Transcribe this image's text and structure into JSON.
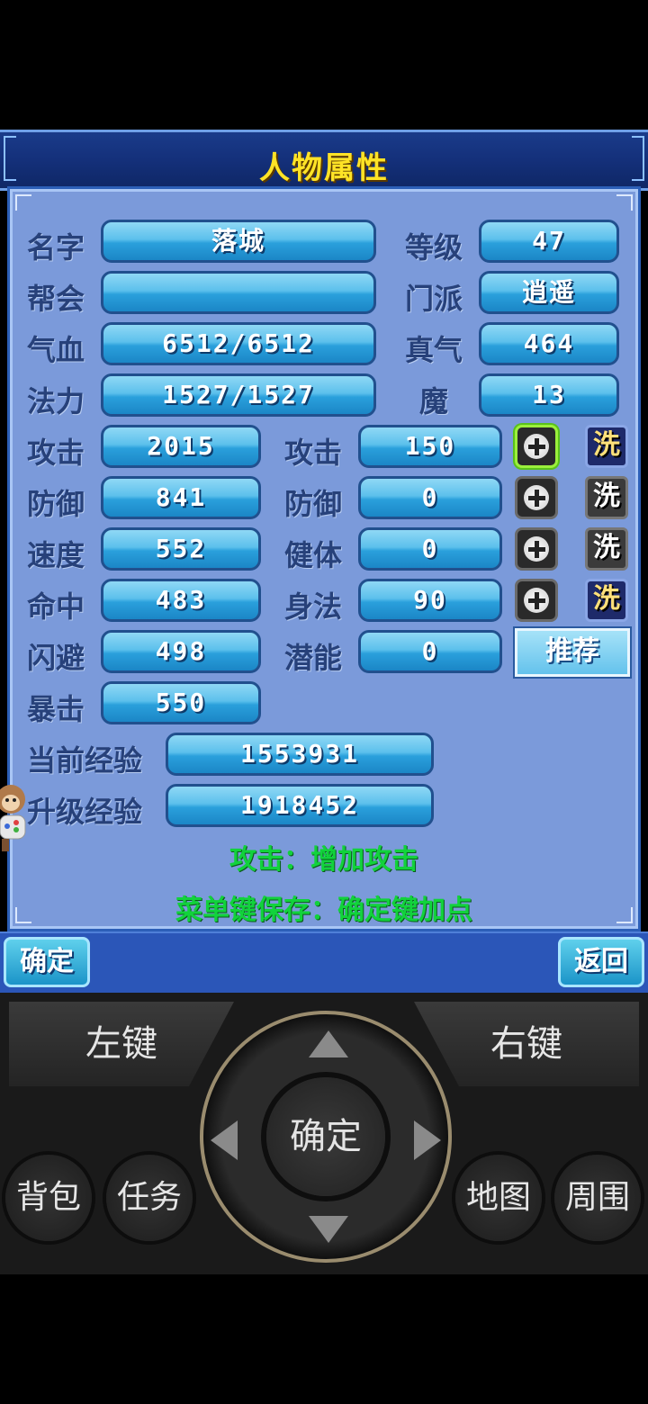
{
  "title": "人物属性",
  "top_rows": [
    {
      "label": "名字",
      "value": "落城",
      "label2": "等级",
      "value2": "47"
    },
    {
      "label": "帮会",
      "value": "",
      "label2": "门派",
      "value2": "逍遥"
    },
    {
      "label": "气血",
      "value": "6512/6512",
      "label2": "真气",
      "value2": "464"
    },
    {
      "label": "法力",
      "value": "1527/1527",
      "label2": "魔",
      "value2": "13"
    }
  ],
  "stat_rows": [
    {
      "label": "攻击",
      "value": "2015",
      "alloc_label": "攻击",
      "alloc_value": "150",
      "wash": "洗"
    },
    {
      "label": "防御",
      "value": "841",
      "alloc_label": "防御",
      "alloc_value": "0",
      "wash": "洗"
    },
    {
      "label": "速度",
      "value": "552",
      "alloc_label": "健体",
      "alloc_value": "0",
      "wash": "洗"
    },
    {
      "label": "命中",
      "value": "483",
      "alloc_label": "身法",
      "alloc_value": "90",
      "wash": "洗"
    },
    {
      "label": "闪避",
      "value": "498",
      "alloc_label": "潜能",
      "alloc_value": "0"
    },
    {
      "label": "暴击",
      "value": "550"
    }
  ],
  "recommend_label": "推荐",
  "exp": {
    "current_label": "当前经验",
    "current_value": "1553931",
    "next_label": "升级经验",
    "next_value": "1918452"
  },
  "hint1": "攻击：增加攻击",
  "hint2": "菜单键保存：确定键加点",
  "softkeys": {
    "confirm": "确定",
    "back": "返回"
  },
  "controller": {
    "left_key": "左键",
    "right_key": "右键",
    "ok": "确定",
    "bag": "背包",
    "quest": "任务",
    "map": "地图",
    "nearby": "周围"
  }
}
